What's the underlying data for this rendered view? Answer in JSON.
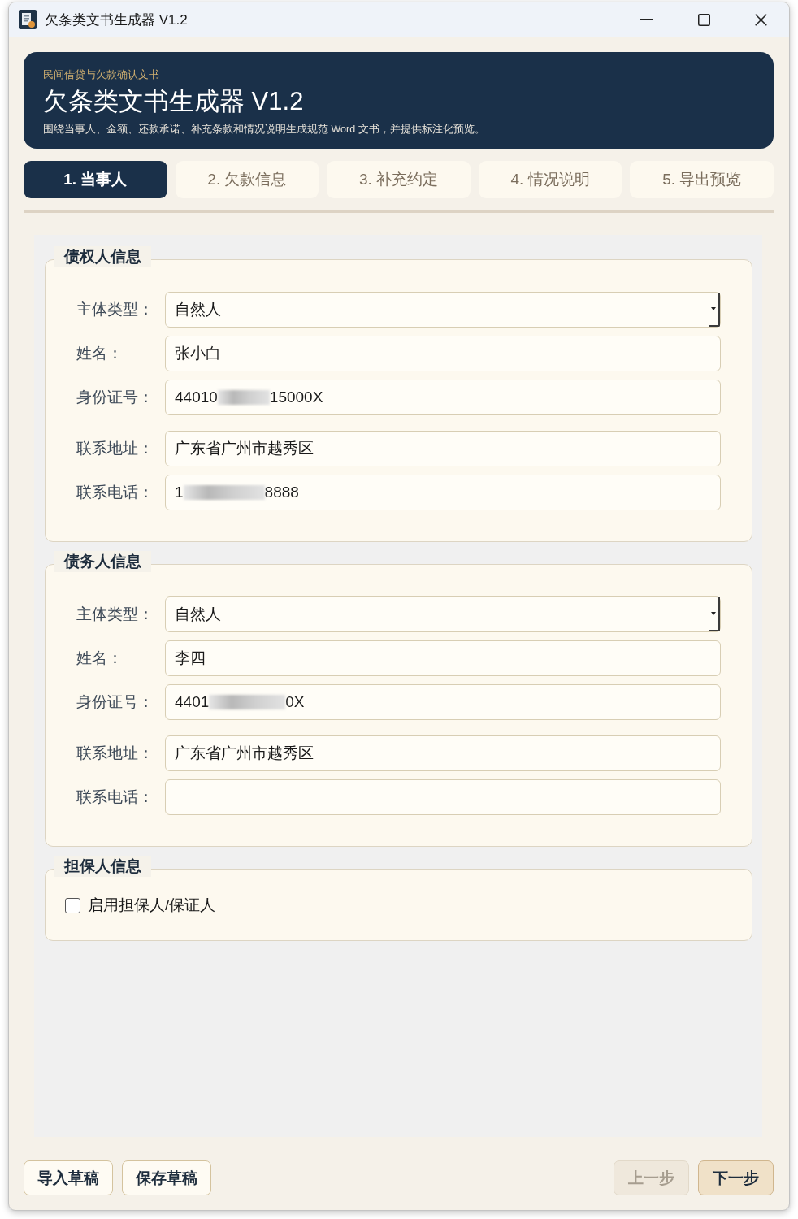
{
  "window": {
    "title": "欠条类文书生成器 V1.2"
  },
  "header": {
    "eyebrow": "民间借贷与欠款确认文书",
    "title": "欠条类文书生成器 V1.2",
    "description": "围绕当事人、金额、还款承诺、补充条款和情况说明生成规范 Word 文书，并提供标注化预览。"
  },
  "steps": [
    {
      "label": "1. 当事人",
      "selected": true
    },
    {
      "label": "2. 欠款信息",
      "selected": false
    },
    {
      "label": "3. 补充约定",
      "selected": false
    },
    {
      "label": "4. 情况说明",
      "selected": false
    },
    {
      "label": "5. 导出预览",
      "selected": false
    }
  ],
  "groups": [
    {
      "title": "债权人信息",
      "fields": [
        {
          "kind": "select",
          "label": "主体类型：",
          "value": "自然人"
        },
        {
          "kind": "text",
          "label": "姓名：",
          "value": "张小白"
        },
        {
          "kind": "masked",
          "label": "身份证号：",
          "value_start": "44010",
          "value_end": "15000X"
        },
        {
          "kind": "text",
          "label": "联系地址：",
          "value": "广东省广州市越秀区"
        },
        {
          "kind": "masked",
          "label": "联系电话：",
          "value_start": "1",
          "value_end": "8888"
        }
      ]
    },
    {
      "title": "债务人信息",
      "fields": [
        {
          "kind": "select",
          "label": "主体类型：",
          "value": "自然人"
        },
        {
          "kind": "text",
          "label": "姓名：",
          "value": "李四"
        },
        {
          "kind": "masked",
          "label": "身份证号：",
          "value_start": "4401",
          "value_end": "0X"
        },
        {
          "kind": "text",
          "label": "联系地址：",
          "value": "广东省广州市越秀区"
        },
        {
          "kind": "text",
          "label": "联系电话："
        }
      ]
    },
    {
      "title": "担保人信息",
      "fields": [
        {
          "kind": "checkbox",
          "label": "启用担保人/保证人",
          "checked": false
        }
      ]
    }
  ],
  "footer": {
    "left_buttons": [
      {
        "label": "导入草稿"
      },
      {
        "label": "保存草稿"
      }
    ],
    "right_buttons": [
      {
        "label": "上一步",
        "disabled": true
      },
      {
        "label": "下一步",
        "disabled": false
      }
    ]
  }
}
